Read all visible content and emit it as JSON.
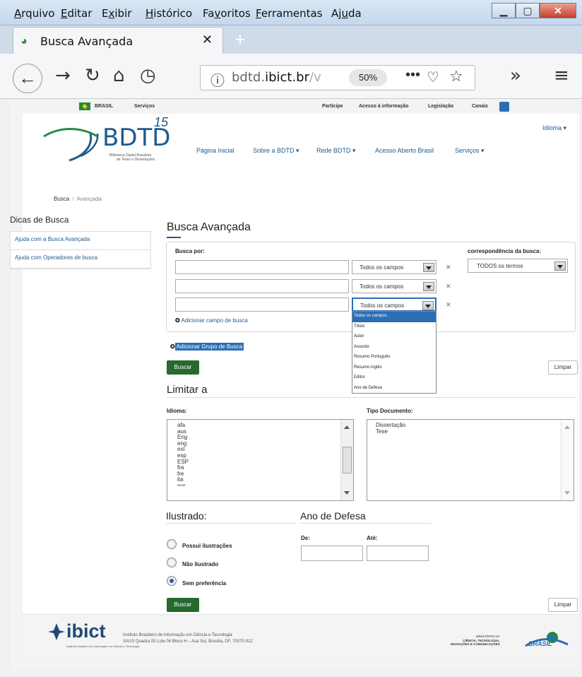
{
  "menubar": {
    "items": [
      {
        "pre": "",
        "u": "A",
        "post": "rquivo"
      },
      {
        "pre": "",
        "u": "E",
        "post": "ditar"
      },
      {
        "pre": "E",
        "u": "x",
        "post": "ibir"
      },
      {
        "pre": "",
        "u": "H",
        "post": "istórico"
      },
      {
        "pre": "Fa",
        "u": "v",
        "post": "oritos"
      },
      {
        "pre": "",
        "u": "F",
        "post": "erramentas"
      },
      {
        "pre": "Aj",
        "u": "u",
        "post": "da"
      }
    ]
  },
  "tab": {
    "title": "Busca Avançada",
    "close": "✕",
    "newtab": "+"
  },
  "nav": {
    "back": "←",
    "forward": "→",
    "reload": "↻",
    "home": "⌂",
    "history": "◷",
    "url_host": "bdtd.",
    "url_bold": "ibict.br",
    "url_rest": "/v",
    "zoom": "50%",
    "more": "•••",
    "overflow": "»",
    "menu": "≡"
  },
  "gov": {
    "brasil": "BRASIL",
    "servicos": "Serviços",
    "participe": "Participe",
    "acesso": "Acesso à informação",
    "legislacao": "Legislação",
    "canais": "Canais"
  },
  "logo": {
    "name": "BDTD",
    "badge": "15",
    "sub1": "Biblioteca Digital Brasileira",
    "sub2": "de Teses e Dissertações"
  },
  "mainnav": {
    "home": "Página Inicial",
    "sobre": "Sobre a BDTD ▾",
    "rede": "Rede BDTD ▾",
    "acesso": "Acesso Aberto Brasil",
    "servicos": "Serviços ▾",
    "idioma": "Idioma ▾"
  },
  "breadcrumb": {
    "busca": "Busca",
    "sep": "/",
    "current": "Avançada"
  },
  "sidebar": {
    "title": "Dicas de Busca",
    "items": [
      {
        "label": "Ajuda com a Busca Avançada"
      },
      {
        "label": "Ajuda com Operadores de busca"
      }
    ]
  },
  "main": {
    "heading": "Busca Avançada",
    "busca_por": "Busca por:",
    "correspondencia": "correspondência da busca:",
    "field_select": "Todos os campos",
    "remove": "✕",
    "match_value": "TODOS os termos",
    "add_field": "Adicionar campo de busca",
    "add_group": "Adicionar Grupo de Busca",
    "buscar": "Buscar",
    "limpar": "Limpar"
  },
  "dropdown": {
    "options": [
      "Todos os campos",
      "Título",
      "Autor",
      "Assunto",
      "Resumo Português",
      "Resumo inglês",
      "Editor",
      "Ano de Defesa"
    ]
  },
  "limitar": {
    "title": "Limitar a",
    "idioma_label": "Idioma:",
    "idioma_opts": [
      "afa",
      "aus",
      "Eng",
      "eng",
      "esl",
      "esp",
      "ESP",
      "fra",
      "fre",
      "ita",
      "por"
    ],
    "tipo_label": "Tipo Documento:",
    "tipo_opts": [
      "Dissertação",
      "Tese"
    ]
  },
  "ilustrado": {
    "title": "Ilustrado:",
    "options": [
      "Possui ilustrações",
      "Não ilustrado",
      "Sem preferência"
    ]
  },
  "ano": {
    "title": "Ano de Defesa",
    "de": "De:",
    "ate": "Até:"
  },
  "footer": {
    "ibict": "ibict",
    "ibict_sub": "Instituto Brasileiro de Informação em Ciência e Tecnologia",
    "addr1": "Instituto Brasileiro de Informação em Ciência e Tecnologia",
    "addr2": "SAUS Quadra 05 Lote 06 Bloco H – Asa Sul, Brasília, DF, 70070-912",
    "mcti1": "MINISTÉRIO DA",
    "mcti2": "CIÊNCIA, TECNOLOGIA,",
    "mcti3": "INOVAÇÕES E COMUNICAÇÕES",
    "brasil": "BRASIL"
  }
}
